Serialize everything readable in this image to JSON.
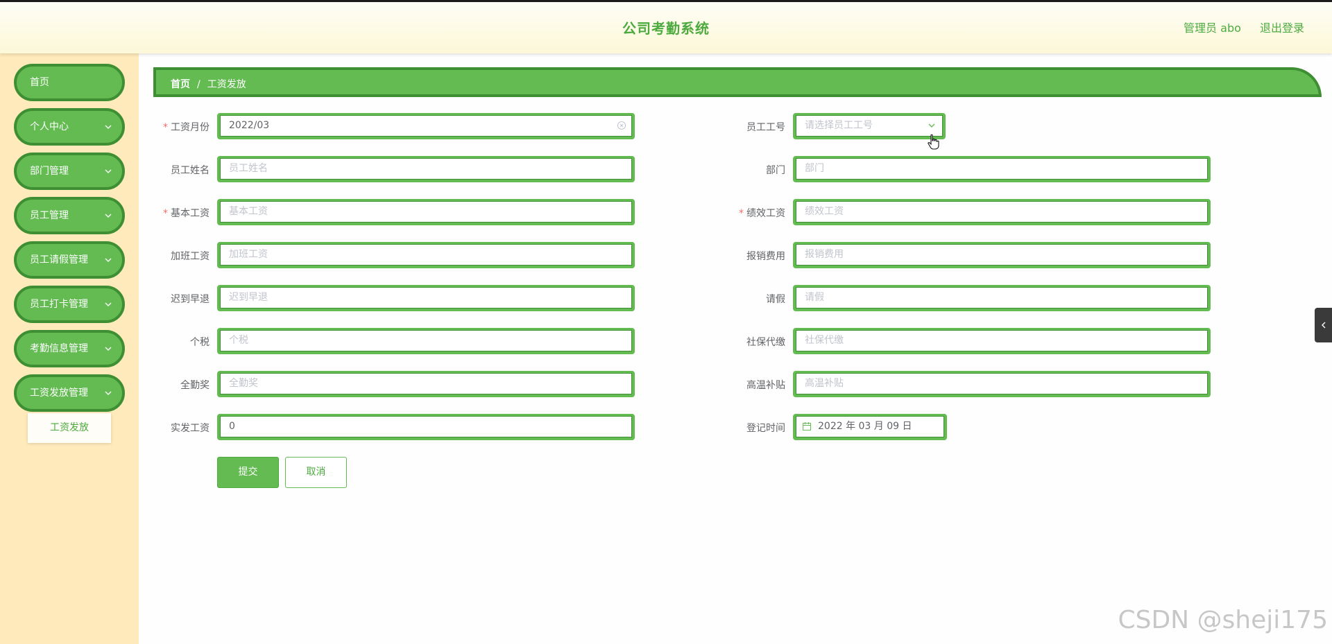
{
  "header": {
    "title": "公司考勤系统",
    "admin": "管理员 abo",
    "logout": "退出登录"
  },
  "sidebar": {
    "items": [
      {
        "label": "首页",
        "has_children": false
      },
      {
        "label": "个人中心",
        "has_children": true
      },
      {
        "label": "部门管理",
        "has_children": true
      },
      {
        "label": "员工管理",
        "has_children": true
      },
      {
        "label": "员工请假管理",
        "has_children": true
      },
      {
        "label": "员工打卡管理",
        "has_children": true
      },
      {
        "label": "考勤信息管理",
        "has_children": true
      },
      {
        "label": "工资发放管理",
        "has_children": true
      }
    ],
    "submenu": {
      "label": "工资发放"
    }
  },
  "breadcrumb": {
    "home": "首页",
    "separator": "/",
    "current": "工资发放"
  },
  "form": {
    "salary_month": {
      "label": "工资月份",
      "required": true,
      "value": "2022/03"
    },
    "employee_id": {
      "label": "员工工号",
      "placeholder": "请选择员工工号"
    },
    "employee_name": {
      "label": "员工姓名",
      "placeholder": "员工姓名"
    },
    "department": {
      "label": "部门",
      "placeholder": "部门"
    },
    "base_salary": {
      "label": "基本工资",
      "required": true,
      "placeholder": "基本工资"
    },
    "performance_salary": {
      "label": "绩效工资",
      "required": true,
      "placeholder": "绩效工资"
    },
    "overtime_pay": {
      "label": "加班工资",
      "placeholder": "加班工资"
    },
    "reimbursement": {
      "label": "报销费用",
      "placeholder": "报销费用"
    },
    "late_early": {
      "label": "迟到早退",
      "placeholder": "迟到早退"
    },
    "leave": {
      "label": "请假",
      "placeholder": "请假"
    },
    "income_tax": {
      "label": "个税",
      "placeholder": "个税"
    },
    "social_insurance": {
      "label": "社保代缴",
      "placeholder": "社保代缴"
    },
    "attendance_bonus": {
      "label": "全勤奖",
      "placeholder": "全勤奖"
    },
    "heat_subsidy": {
      "label": "高温补贴",
      "placeholder": "高温补贴"
    },
    "actual_salary": {
      "label": "实发工资",
      "value": "0"
    },
    "register_time": {
      "label": "登记时间",
      "value": "2022 年 03 月 09 日"
    },
    "required_mark": "*"
  },
  "buttons": {
    "submit": "提交",
    "cancel": "取消"
  },
  "watermark": "CSDN @sheji175",
  "colors": {
    "accent": "#63bb52",
    "accent_dark": "#3e8e33",
    "sidebar_bg": "#ffeabb",
    "required": "#f56c6c"
  }
}
